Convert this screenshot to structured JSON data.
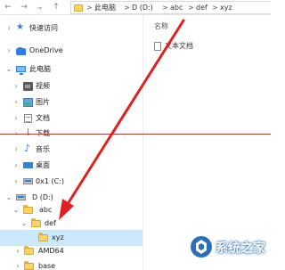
{
  "address_bar": {
    "path": [
      "此电脑",
      "D (D:)",
      "abc",
      "def",
      "xyz"
    ],
    "separator": ">"
  },
  "nav_tree": {
    "items": [
      {
        "label": "快速访问",
        "icon": "star-icon"
      },
      {
        "label": "OneDrive",
        "icon": "onedrive-cloud-icon"
      },
      {
        "label": "此电脑",
        "icon": "computer-icon"
      },
      {
        "label": "视频",
        "icon": "videos-folder-icon"
      },
      {
        "label": "图片",
        "icon": "pictures-folder-icon"
      },
      {
        "label": "文档",
        "icon": "documents-folder-icon"
      },
      {
        "label": "下载",
        "icon": "downloads-icon"
      },
      {
        "label": "音乐",
        "icon": "music-icon"
      },
      {
        "label": "桌面",
        "icon": "desktop-icon"
      },
      {
        "label": "0x1 (C:)",
        "icon": "drive-icon"
      },
      {
        "label": "D (D:)",
        "icon": "drive-icon"
      },
      {
        "label": "abc",
        "icon": "folder-icon"
      },
      {
        "label": "def",
        "icon": "folder-icon"
      },
      {
        "label": "xyz",
        "icon": "folder-icon",
        "selected": true
      },
      {
        "label": "AMD64",
        "icon": "folder-icon"
      },
      {
        "label": "base",
        "icon": "folder-icon"
      }
    ]
  },
  "content": {
    "column_header": "名称",
    "files": [
      {
        "name": "文本文档",
        "icon": "text-file-icon"
      }
    ]
  },
  "watermark": {
    "text": "系统之家"
  },
  "colors": {
    "selected_bg": "#cce8ff",
    "annotation_arrow": "#e02020",
    "annotation_line": "#a8423a",
    "folder_yellow": "#f7d36a"
  }
}
